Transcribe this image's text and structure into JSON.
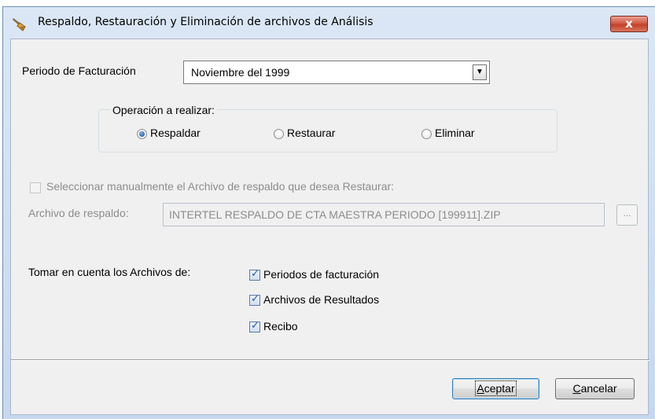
{
  "dialog": {
    "title": "Respaldo, Restauración y Eliminación de archivos de Análisis",
    "close_label": "x"
  },
  "billing_period": {
    "label": "Periodo de Facturación",
    "selected_value": "Noviembre del 1999",
    "dropdown_arrow": "▼"
  },
  "operation": {
    "group_title": "Operación a realizar:",
    "options": [
      {
        "label": "Respaldar",
        "selected": true
      },
      {
        "label": "Restaurar",
        "selected": false
      },
      {
        "label": "Eliminar",
        "selected": false
      }
    ]
  },
  "manual_select": {
    "label": "Seleccionar manualmente el Archivo de respaldo que desea Restaurar:",
    "checked": false,
    "enabled": false
  },
  "backup_file": {
    "label": "Archivo de respaldo:",
    "value": "INTERTEL RESPALDO DE CTA  MAESTRA PERIODO [199911].ZIP",
    "browse_label": "..."
  },
  "include_files": {
    "label": "Tomar en cuenta los Archivos de:",
    "options": [
      {
        "label": "Periodos de facturación",
        "checked": true
      },
      {
        "label": "Archivos de Resultados",
        "checked": true
      },
      {
        "label": "Recibo",
        "checked": true
      }
    ]
  },
  "buttons": {
    "accept_mnemonic": "A",
    "accept_rest": "ceptar",
    "cancel_mnemonic": "C",
    "cancel_rest": "ancelar"
  },
  "colors": {
    "title_gradient_top": "#dbe7f5",
    "close_button": "#c2402a",
    "client_background": "#f0f0f0",
    "disabled_text": "#8c8c8c",
    "radio_selected": "#1d5fa8"
  }
}
